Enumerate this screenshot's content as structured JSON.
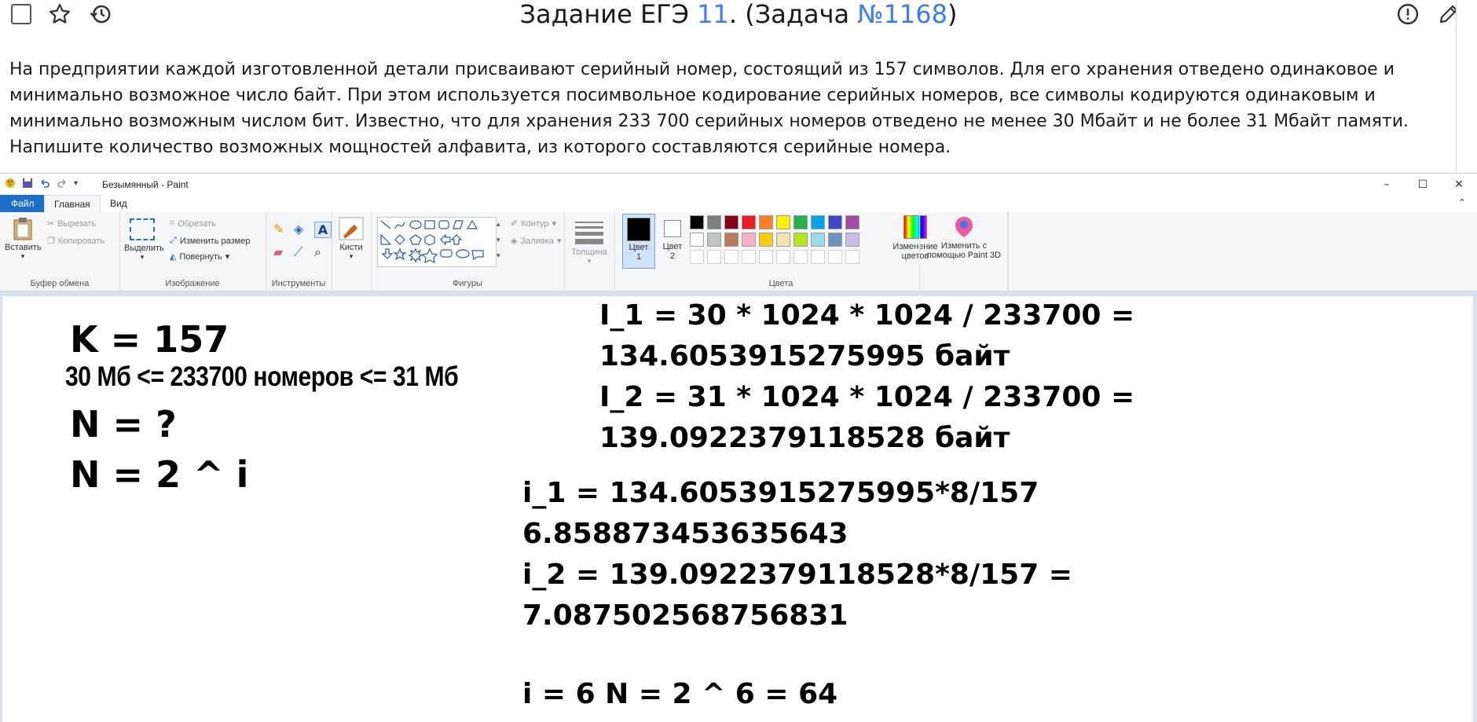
{
  "header": {
    "title_prefix": "Задание ЕГЭ ",
    "task_number": "11",
    "title_middle": ". (Задача ",
    "problem_number": "№1168",
    "title_suffix": ")",
    "icons": [
      "checkbox-icon",
      "star-icon",
      "history-icon",
      "report-icon",
      "edit-icon"
    ]
  },
  "task_text": "На предприятии каждой изготовленной детали присваивают серийный номер, состоящий из 157 символов. Для его хранения отведено одинаковое и минимально возможное число байт. При этом используется посимвольное кодирование серийных номеров, все символы кодируются одинаковым и минимально возможным числом бит. Известно, что для хранения 233 700 серийных номеров отведено не менее 30 Мбайт и  не более 31 Мбайт памяти. Напишите количество возможных мощностей алфавита, из которого составляются серийные номера.",
  "paint": {
    "window_title": "Безымянный - Paint",
    "window_controls": [
      "–",
      "☐",
      "✕"
    ],
    "tabs": {
      "file": "Файл",
      "home": "Главная",
      "view": "Вид"
    },
    "clipboard": {
      "paste": "Вставить",
      "cut": "Вырезать",
      "copy": "Копировать",
      "label": "Буфер обмена"
    },
    "image": {
      "select": "Выделить",
      "crop": "Обрезать",
      "resize": "Изменить размер",
      "rotate": "Повернуть",
      "label": "Изображение"
    },
    "tools": {
      "label": "Инструменты"
    },
    "brushes": {
      "label": "Кисти"
    },
    "shapes": {
      "outline": "Контур",
      "fill": "Заливка",
      "label": "Фигуры"
    },
    "thickness": {
      "label": "Толщина"
    },
    "colors": {
      "color1": "Цвет 1",
      "color2": "Цвет 2",
      "edit": "Изменение цветов",
      "paint3d": "Изменить с помощью Paint 3D",
      "label": "Цвета",
      "palette_row1": [
        "#000000",
        "#7f7f7f",
        "#880015",
        "#ed1c24",
        "#ff7f27",
        "#fff200",
        "#22b14c",
        "#00a2e8",
        "#3f48cc",
        "#a349a4"
      ],
      "palette_row2": [
        "#ffffff",
        "#c3c3c3",
        "#b97a57",
        "#ffaec9",
        "#ffc90e",
        "#efe4b0",
        "#b5e61d",
        "#99d9ea",
        "#7092be",
        "#c8bfe7"
      ]
    }
  },
  "canvas": {
    "k_line": "K = 157",
    "range_line": "30 Мб <= 233700 номеров <= 31 Мб",
    "n_question": "N = ?",
    "n_formula": "N = 2 ^ i",
    "I1_line1": "I_1 = 30 * 1024 * 1024 / 233700 =",
    "I1_line2": "134.6053915275995 байт",
    "I2_line1": "I_2 = 31 * 1024 * 1024 / 233700 =",
    "I2_line2": "139.0922379118528 байт",
    "i1_line1": "i_1 = 134.6053915275995*8/157",
    "i1_line2": "6.858873453635643",
    "i2_line1": "i_2 = 139.0922379118528*8/157 =",
    "i2_line2": "7.087502568756831",
    "answer": "i = 6  N = 2 ^ 6 = 64"
  }
}
